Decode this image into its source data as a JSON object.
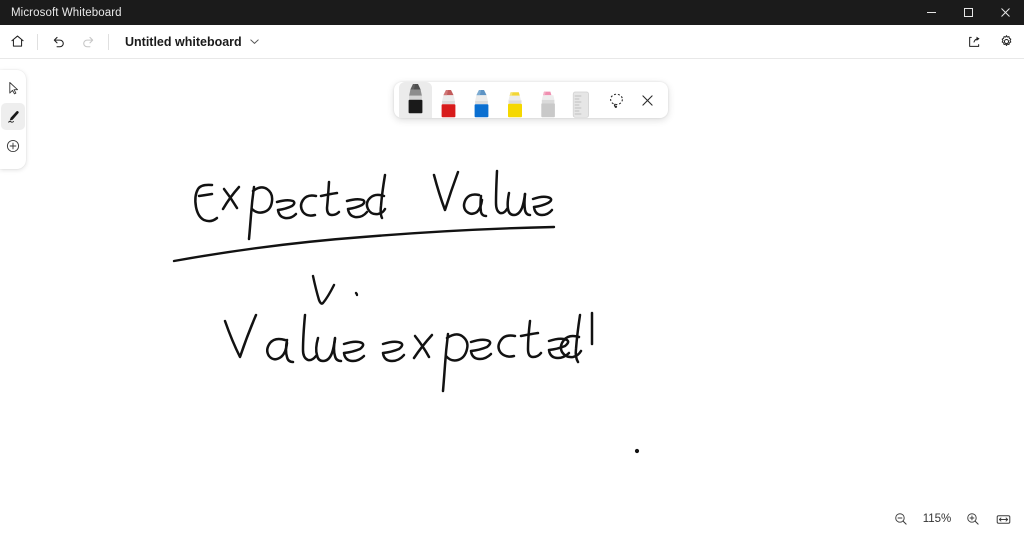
{
  "window": {
    "app_title": "Microsoft Whiteboard",
    "controls": [
      {
        "name": "minimize-button",
        "glyph": "minimize"
      },
      {
        "name": "maximize-button",
        "glyph": "maximize"
      },
      {
        "name": "close-button",
        "glyph": "close"
      }
    ]
  },
  "header": {
    "home_label": "Home",
    "undo_label": "Undo",
    "redo_label": "Redo",
    "redo_disabled": true,
    "document_title": "Untitled whiteboard",
    "title_chevron": "chevron-down",
    "share_label": "Share",
    "settings_label": "Settings"
  },
  "rail": {
    "items": [
      {
        "name": "select-tool",
        "label": "Select",
        "icon": "cursor-icon",
        "selected": false
      },
      {
        "name": "ink-tool",
        "label": "Inking",
        "icon": "pen-icon",
        "selected": true
      },
      {
        "name": "create-tool",
        "label": "Create",
        "icon": "plus-circle-icon",
        "selected": false
      }
    ]
  },
  "pen_toolbar": {
    "pens": [
      {
        "name": "pen-black",
        "label": "Black pen",
        "color": "#1a1a1a",
        "cap": "#6b6b6b",
        "selected": true
      },
      {
        "name": "pen-red",
        "label": "Red pen",
        "color": "#d81c1c",
        "cap": "#d06060",
        "selected": false
      },
      {
        "name": "pen-blue",
        "label": "Blue pen",
        "color": "#0a6fd1",
        "cap": "#5a9ed8",
        "selected": false
      },
      {
        "name": "pen-yellow",
        "label": "Yellow highlighter",
        "color": "#f5d800",
        "cap": "#f2da2a",
        "selected": false
      },
      {
        "name": "eraser",
        "label": "Eraser",
        "color": "#c9c9c9",
        "cap": "#f08fb0",
        "selected": false
      },
      {
        "name": "ruler",
        "label": "Ruler",
        "color": "#d4d4d4",
        "cap": "#d9d9d9",
        "selected": false
      }
    ],
    "lasso_label": "Lasso select",
    "close_label": "Close pen tray"
  },
  "canvas": {
    "strokes": [
      {
        "name": "ink-text-expected-value",
        "text": "Expected Value"
      },
      {
        "name": "ink-underline",
        "text": "underline"
      },
      {
        "name": "ink-arrow-down",
        "text": "down arrow"
      },
      {
        "name": "ink-text-value-expected",
        "text": "Value expected!"
      },
      {
        "name": "ink-dot",
        "text": "dot"
      }
    ]
  },
  "zoom": {
    "zoom_out_label": "Zoom out",
    "level": "115%",
    "zoom_in_label": "Zoom in",
    "fit_label": "Fit to screen"
  }
}
